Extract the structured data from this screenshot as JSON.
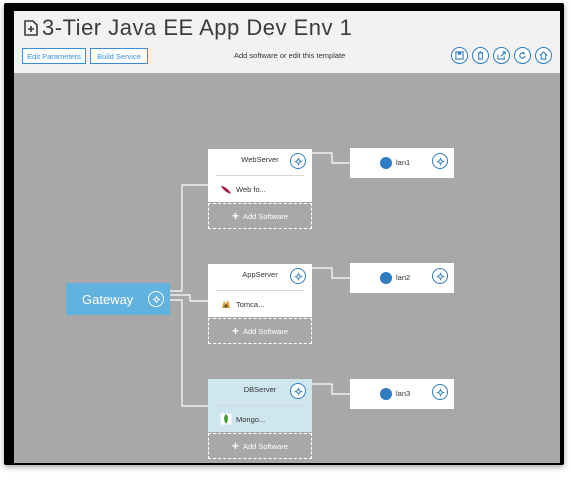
{
  "header": {
    "title": "3-Tier Java EE App Dev Env 1",
    "hint": "Add software or edit this template",
    "buttons": {
      "edit_parameters": "Edit Parameters",
      "build_service": "Build Service"
    },
    "toolbar_icons": [
      "save-icon",
      "delete-icon",
      "export-icon",
      "refresh-icon",
      "home-icon"
    ]
  },
  "gateway": {
    "label": "Gateway"
  },
  "servers": [
    {
      "name": "WebServer",
      "software": "Web fo...",
      "software_icon": "feather-icon"
    },
    {
      "name": "AppServer",
      "software": "Tomca...",
      "software_icon": "tomcat-icon"
    },
    {
      "name": "DBServer",
      "software": "Mongo...",
      "software_icon": "mongodb-leaf-icon"
    }
  ],
  "add_software_label": "Add Software",
  "lans": [
    {
      "name": "lan1"
    },
    {
      "name": "lan2"
    },
    {
      "name": "lan3"
    }
  ],
  "colors": {
    "accent": "#3a8fd4",
    "gateway": "#62b2df",
    "canvas": "#a8a8a8",
    "db_server_bg": "#cfe6ef"
  }
}
